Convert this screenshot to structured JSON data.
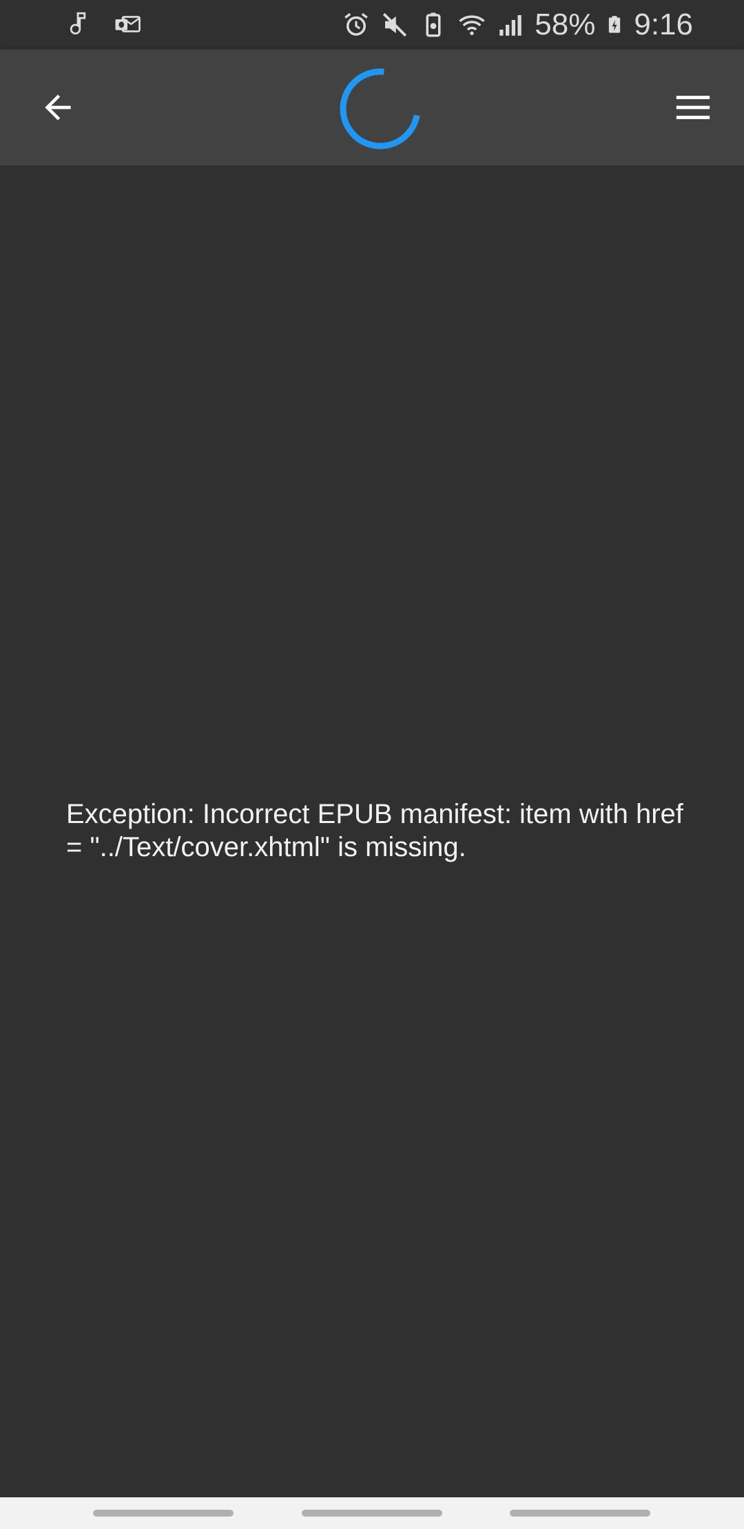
{
  "status_bar": {
    "left_icons": [
      "music-note-icon",
      "outlook-icon"
    ],
    "right_icons": [
      "alarm-icon",
      "mute-icon",
      "battery-saver-icon",
      "wifi-icon",
      "signal-icon"
    ],
    "battery": "58%",
    "time": "9:16"
  },
  "app_bar": {
    "back_icon": "arrow-back-icon",
    "menu_icon": "hamburger-menu-icon",
    "loading_indicator": "spinner",
    "accent_color": "#2196F3"
  },
  "content": {
    "error_message": "Exception: Incorrect EPUB manifest: item with href = \"../Text/cover.xhtml\" is missing."
  },
  "colors": {
    "background": "#303030",
    "app_bar": "#424242",
    "text": "#F2F2F2",
    "nav_bar": "#F2F2F2"
  }
}
